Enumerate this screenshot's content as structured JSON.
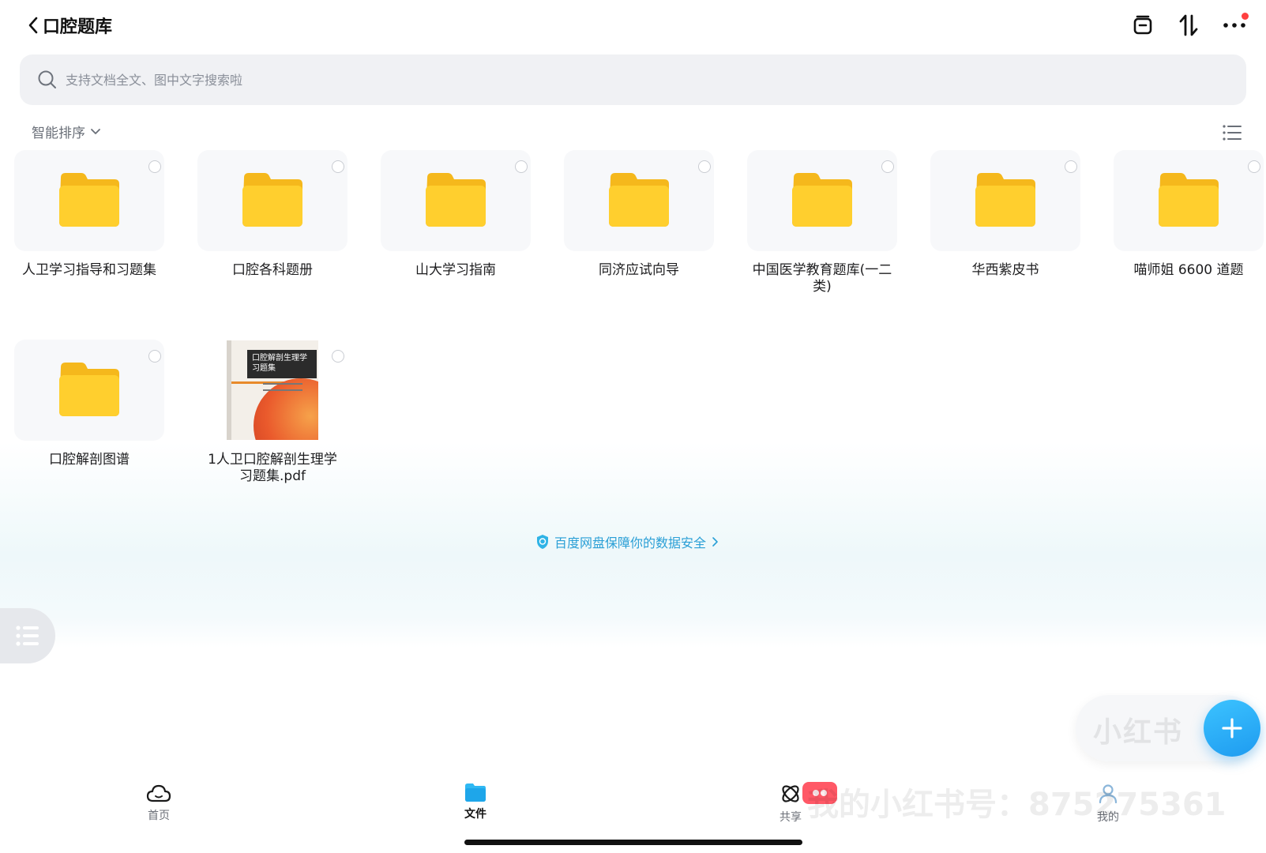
{
  "header": {
    "title": "口腔题库",
    "icons": [
      "back-chevron-icon",
      "transfer-box-icon",
      "sort-arrows-icon",
      "more-icon"
    ]
  },
  "search": {
    "placeholder": "支持文档全文、图中文字搜索啦"
  },
  "sort": {
    "label": "智能排序"
  },
  "items": [
    {
      "name": "人卫学习指导和习题集",
      "type": "folder"
    },
    {
      "name": "口腔各科题册",
      "type": "folder"
    },
    {
      "name": "山大学习指南",
      "type": "folder"
    },
    {
      "name": "同济应试向导",
      "type": "folder"
    },
    {
      "name": "中国医学教育题库(一二类)",
      "type": "folder"
    },
    {
      "name": "华西紫皮书",
      "type": "folder"
    },
    {
      "name": "喵师姐 6600 道题",
      "type": "folder"
    },
    {
      "name": "口腔解剖图谱",
      "type": "folder"
    },
    {
      "name": "1人卫口腔解剖生理学习题集.pdf",
      "type": "pdf",
      "cover_title": "口腔解剖生理学习题集"
    }
  ],
  "security_link": "百度网盘保障你的数据安全",
  "watermark": {
    "brand": "小红书",
    "text": "我的小红书号：875275361"
  },
  "tabs": [
    {
      "label": "首页",
      "icon": "cloud-icon",
      "active": false
    },
    {
      "label": "文件",
      "icon": "folder-icon",
      "active": true
    },
    {
      "label": "共享",
      "icon": "share-atom-icon",
      "active": false
    },
    {
      "label": "我的",
      "icon": "profile-icon",
      "active": false
    }
  ],
  "colors": {
    "accent": "#1e9bf0",
    "folder": "#ffc928",
    "link": "#2a9fd6",
    "badge": "#ff4040"
  }
}
